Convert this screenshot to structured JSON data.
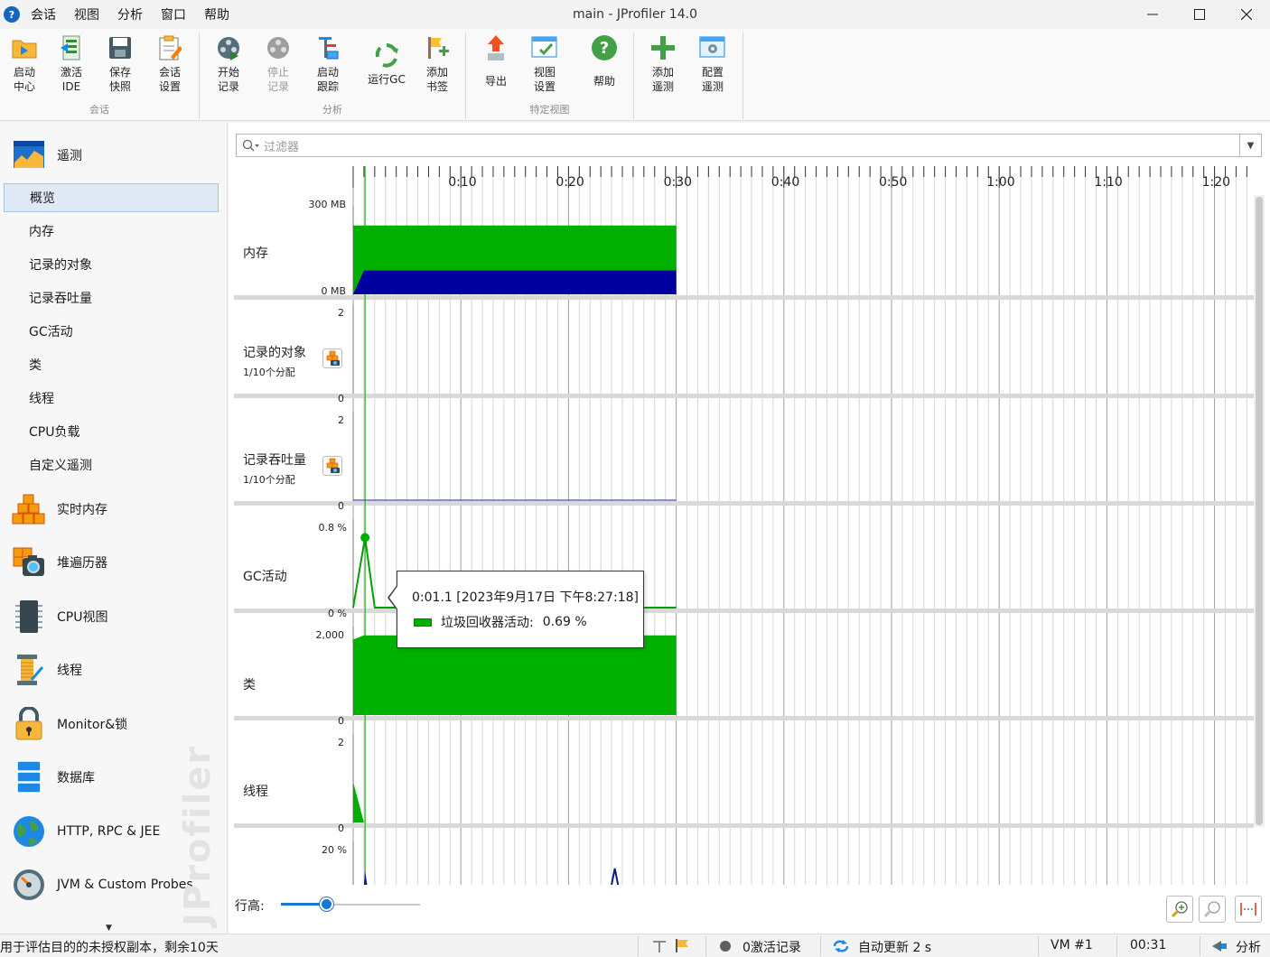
{
  "window": {
    "title": "main - JProfiler 14.0",
    "menu": [
      "会话",
      "视图",
      "分析",
      "窗口",
      "帮助"
    ]
  },
  "toolbar": {
    "groups": [
      {
        "label": "会话",
        "buttons": [
          {
            "label": "启动\n中心",
            "icon": "start-center-icon"
          },
          {
            "label": "激活\nIDE",
            "icon": "activate-ide-icon"
          },
          {
            "label": "保存\n快照",
            "icon": "save-snapshot-icon"
          },
          {
            "label": "会话\n设置",
            "icon": "session-settings-icon"
          }
        ]
      },
      {
        "label": "分析",
        "buttons": [
          {
            "label": "开始\n记录",
            "icon": "start-recording-icon"
          },
          {
            "label": "停止\n记录",
            "icon": "stop-recording-icon",
            "disabled": true
          },
          {
            "label": "启动\n跟踪",
            "icon": "start-tracking-icon"
          },
          {
            "label": "运行GC",
            "icon": "run-gc-icon"
          },
          {
            "label": "添加\n书签",
            "icon": "add-bookmark-icon"
          }
        ]
      },
      {
        "label": "特定视图",
        "buttons": [
          {
            "label": "导出",
            "icon": "export-icon"
          },
          {
            "label": "视图\n设置",
            "icon": "view-settings-icon"
          },
          {
            "label": "帮助",
            "icon": "help-icon"
          }
        ]
      },
      {
        "label": "",
        "buttons": [
          {
            "label": "添加\n遥测",
            "icon": "add-telemetry-icon"
          },
          {
            "label": "配置\n遥测",
            "icon": "configure-telemetry-icon"
          }
        ]
      }
    ]
  },
  "sidebar": {
    "telemetry": "遥测",
    "telemetry_items": [
      "概览",
      "内存",
      "记录的对象",
      "记录吞吐量",
      "GC活动",
      "类",
      "线程",
      "CPU负载",
      "自定义遥测"
    ],
    "sections": [
      "实时内存",
      "堆遍历器",
      "CPU视图",
      "线程",
      "Monitor&锁",
      "数据库",
      "HTTP, RPC & JEE",
      "JVM & Custom Probes"
    ],
    "watermark": "JProfiler"
  },
  "main": {
    "filter_placeholder": "过滤器",
    "timeline_ticks": [
      "0:10",
      "0:20",
      "0:30",
      "0:40",
      "0:50",
      "1:00",
      "1:10",
      "1:20"
    ],
    "rows": [
      {
        "label": "内存",
        "top_label": "300 MB",
        "bottom_label": "0 MB"
      },
      {
        "label": "记录的对象",
        "sub": "1/10个分配",
        "top_label": "2",
        "bottom_label": "0"
      },
      {
        "label": "记录吞吐量",
        "sub": "1/10个分配",
        "top_label": "2",
        "bottom_label": "0"
      },
      {
        "label": "GC活动",
        "top_label": "0.8 %",
        "bottom_label": "0 %"
      },
      {
        "label": "类",
        "top_label": "2,000",
        "bottom_label": "0"
      },
      {
        "label": "线程",
        "top_label": "2",
        "bottom_label": "0"
      },
      {
        "label": "",
        "top_label": "20 %"
      }
    ],
    "tooltip": {
      "time": "0:01.1 [2023年9月17日 下午8:27:18]",
      "series": "垃圾回收器活动:",
      "value": "0.69 %"
    },
    "row_height_label": "行高:",
    "row_height_value": 0.33
  },
  "statusbar": {
    "license": "用于评估目的的未授权副本，剩余10天",
    "recordings": "0激活记录",
    "auto_update": "自动更新 2 s",
    "vm": "VM #1",
    "time": "00:31",
    "mode": "分析"
  },
  "colors": {
    "heap_used": "#00b000",
    "heap_free": "#0000a0",
    "accent": "#1976d2",
    "grid": "#c8c8c8"
  }
}
